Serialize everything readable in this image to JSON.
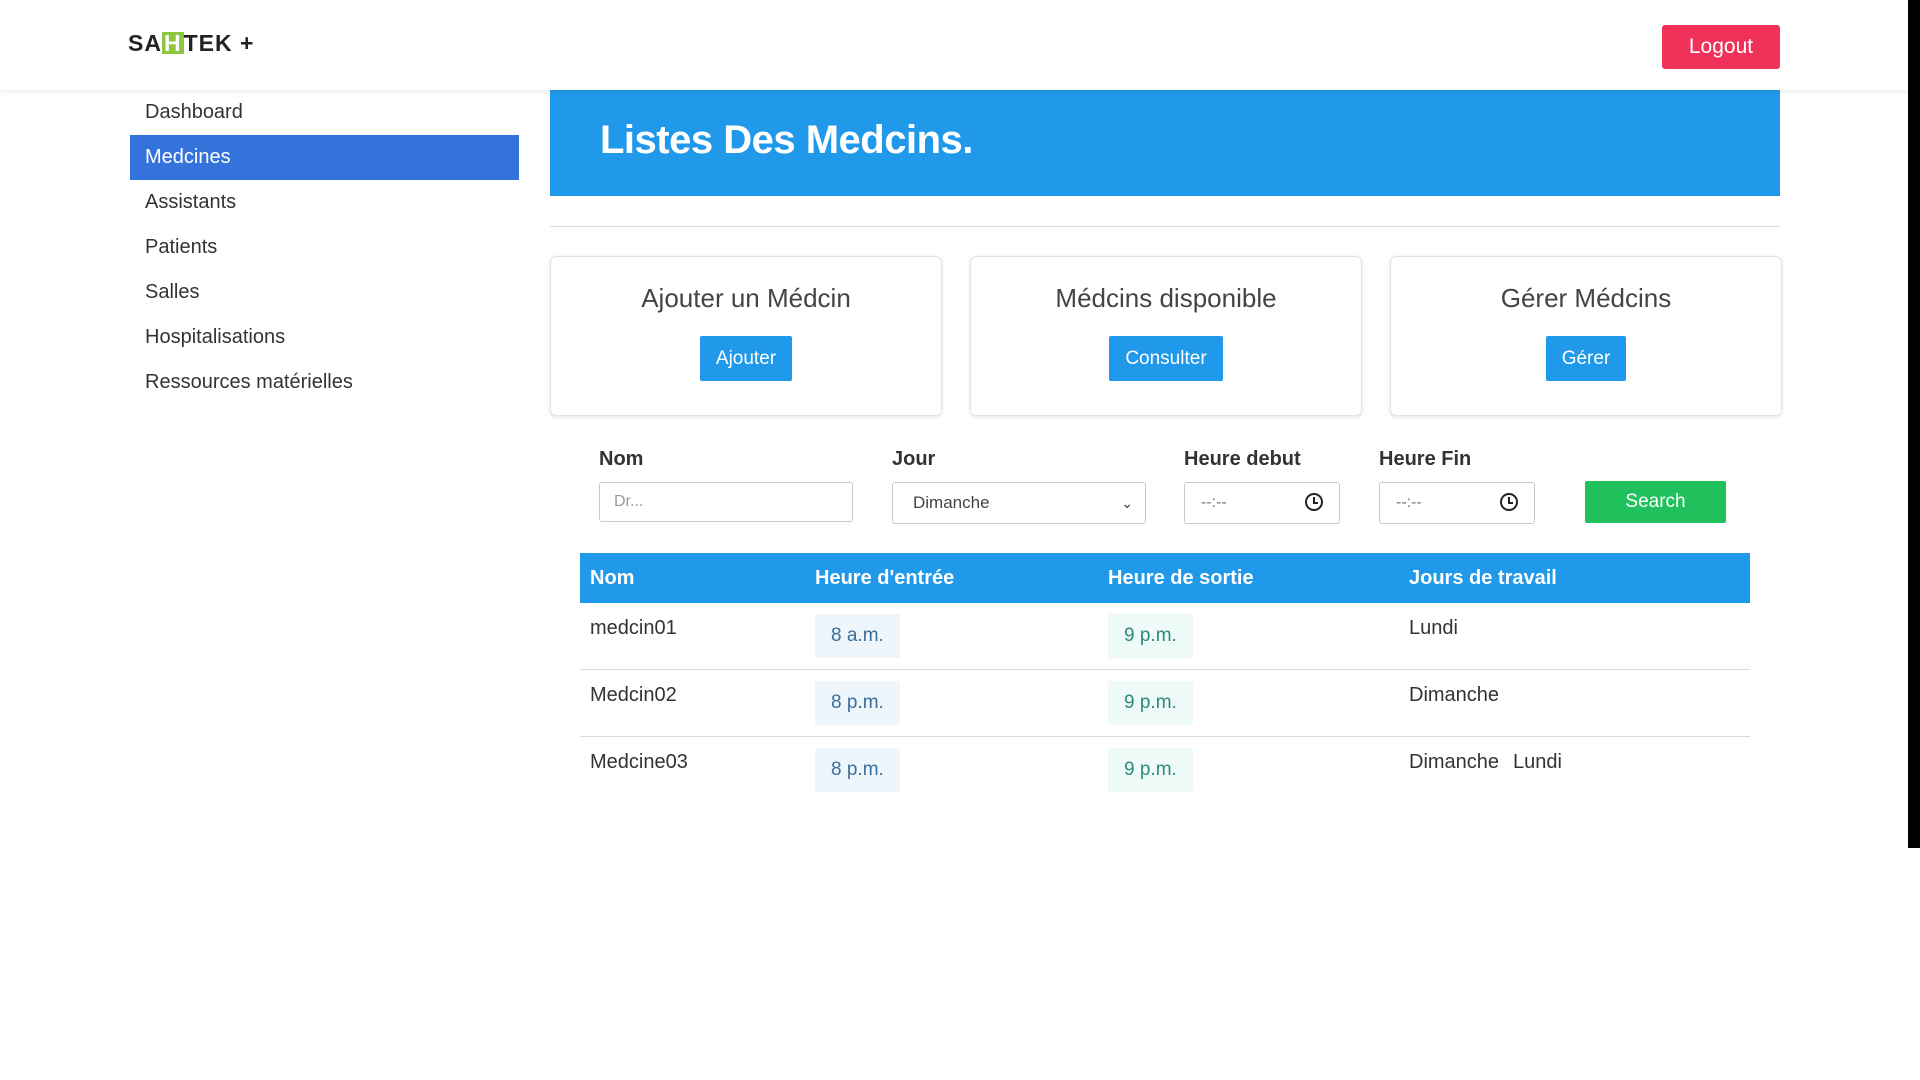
{
  "brand": {
    "prefix": "SA",
    "highlight": "H",
    "suffix": "TEK +"
  },
  "header": {
    "logout_label": "Logout"
  },
  "sidebar": {
    "items": [
      {
        "label": "Dashboard",
        "active": false
      },
      {
        "label": "Medcines",
        "active": true
      },
      {
        "label": "Assistants",
        "active": false
      },
      {
        "label": "Patients",
        "active": false
      },
      {
        "label": "Salles",
        "active": false
      },
      {
        "label": "Hospitalisations",
        "active": false
      },
      {
        "label": "Ressources matérielles",
        "active": false
      }
    ]
  },
  "page": {
    "title": "Listes Des Medcins."
  },
  "cards": [
    {
      "title": "Ajouter un Médcin",
      "button": "Ajouter"
    },
    {
      "title": "Médcins disponible",
      "button": "Consulter"
    },
    {
      "title": "Gérer Médcins",
      "button": "Gérer"
    }
  ],
  "filters": {
    "nom_label": "Nom",
    "nom_placeholder": "Dr...",
    "jour_label": "Jour",
    "jour_value": "Dimanche",
    "debut_label": "Heure debut",
    "debut_value": "--:--",
    "fin_label": "Heure Fin",
    "fin_value": "--:--",
    "search_label": "Search"
  },
  "table": {
    "headers": [
      "Nom",
      "Heure d'entrée",
      "Heure de sortie",
      "Jours de travail"
    ],
    "rows": [
      {
        "nom": "medcin01",
        "entree": "8 a.m.",
        "sortie": "9 p.m.",
        "jours": [
          "Lundi"
        ]
      },
      {
        "nom": "Medcin02",
        "entree": "8 p.m.",
        "sortie": "9 p.m.",
        "jours": [
          "Dimanche"
        ]
      },
      {
        "nom": "Medcine03",
        "entree": "8 p.m.",
        "sortie": "9 p.m.",
        "jours": [
          "Dimanche",
          "Lundi"
        ]
      }
    ]
  },
  "colors": {
    "primary": "#2199ea",
    "sidebar_active": "#3473dc",
    "logout": "#f0325a",
    "search": "#20c05c",
    "brand_highlight": "#8dc63f"
  }
}
